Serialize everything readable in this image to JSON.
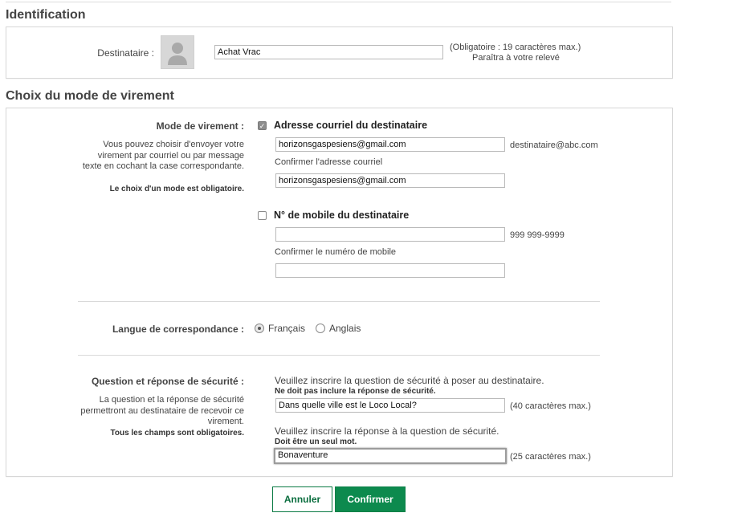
{
  "identification": {
    "title": "Identification",
    "recipient_label": "Destinataire :",
    "recipient_value": "Achat Vrac",
    "note_line1": "(Obligatoire : 19 caractères max.)",
    "note_line2": "Paraîtra à votre relevé"
  },
  "transfer": {
    "title": "Choix du mode de virement",
    "mode_label": "Mode de virement :",
    "mode_desc": "Vous pouvez choisir d'envoyer votre virement par courriel ou par message texte en cochant la case correspondante.",
    "mode_required": "Le choix d'un mode est obligatoire.",
    "email": {
      "checked": true,
      "label": "Adresse courriel du destinataire",
      "value": "horizonsgaspesiens@gmail.com",
      "hint": "destinataire@abc.com",
      "confirm_label": "Confirmer l'adresse courriel",
      "confirm_value": "horizonsgaspesiens@gmail.com"
    },
    "mobile": {
      "checked": false,
      "label": "N° de mobile du destinataire",
      "value": "",
      "hint": "999 999-9999",
      "confirm_label": "Confirmer le numéro de mobile",
      "confirm_value": ""
    },
    "language": {
      "label": "Langue de correspondance :",
      "options": [
        "Français",
        "Anglais"
      ],
      "selected": "Français"
    },
    "security": {
      "label": "Question et réponse de sécurité :",
      "desc": "La question et la réponse de sécurité permettront au destinataire de recevoir ce virement.",
      "required": "Tous les champs sont obligatoires.",
      "question_prompt": "Veuillez inscrire la question de sécurité à poser au destinataire.",
      "question_note": "Ne doit pas inclure la réponse de sécurité.",
      "question_value": "Dans quelle ville est le Loco Local?",
      "question_limit": "(40 caractères max.)",
      "answer_prompt": "Veuillez inscrire la réponse à la question de sécurité.",
      "answer_note": "Doit être un seul mot.",
      "answer_value": "Bonaventure",
      "answer_limit": "(25 caractères max.)"
    }
  },
  "actions": {
    "cancel_label": "Annuler",
    "confirm_label": "Confirmer"
  },
  "colors": {
    "primary": "#0d8a4e",
    "section_text": "#444444"
  }
}
